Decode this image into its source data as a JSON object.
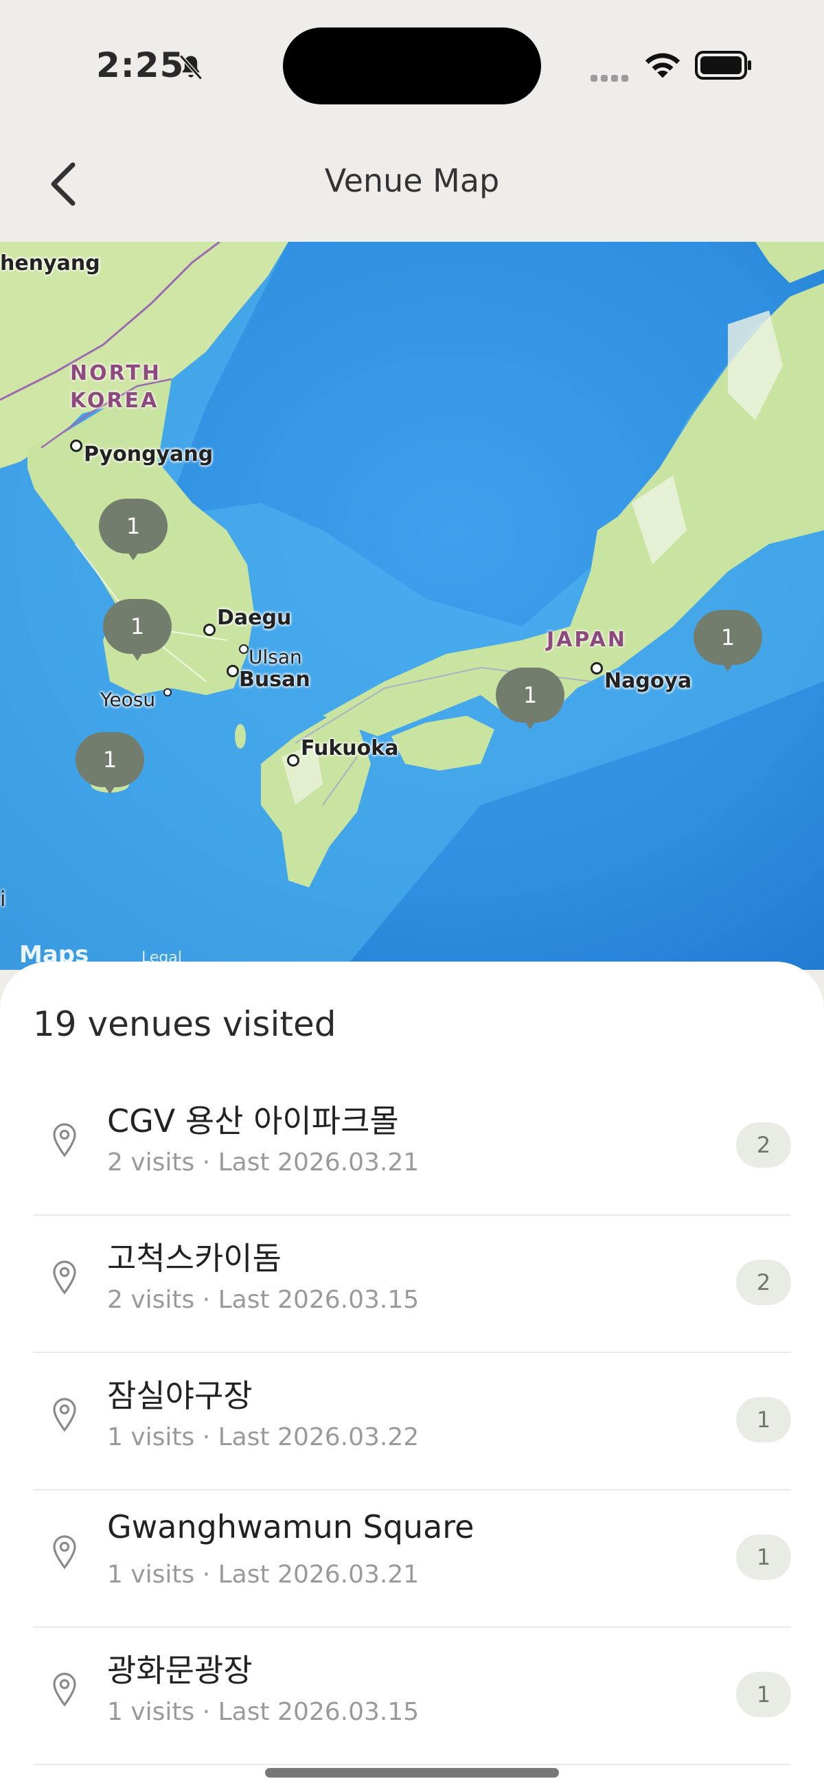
{
  "status": {
    "time": "2:25"
  },
  "header": {
    "title": "Venue Map"
  },
  "map": {
    "labels": {
      "shenyang": "henyang",
      "pyongyang": "Pyongyang",
      "daegu": "Daegu",
      "ulsan": "Ulsan",
      "busan": "Busan",
      "yeosu": "Yeosu",
      "fukuoka": "Fukuoka",
      "nagoya": "Nagoya",
      "edge": "i"
    },
    "countries": {
      "north_korea_1": "NORTH",
      "north_korea_2": "KOREA",
      "japan": "JAPAN"
    },
    "pins": [
      "1",
      "1",
      "1",
      "1",
      "1"
    ],
    "attribution": {
      "logo": "Maps",
      "legal": "Legal"
    }
  },
  "sheet": {
    "summary": "19 venues visited",
    "venues": [
      {
        "name": "CGV 용산 아이파크몰",
        "meta": "2 visits · Last 2026.03.21",
        "count": "2"
      },
      {
        "name": "고척스카이돔",
        "meta": "2 visits · Last 2026.03.15",
        "count": "2"
      },
      {
        "name": "잠실야구장",
        "meta": "1 visits · Last 2026.03.22",
        "count": "1"
      },
      {
        "name": "Gwanghwamun Square",
        "meta": "1 visits · Last 2026.03.21",
        "count": "1"
      },
      {
        "name": "광화문광장",
        "meta": "1 visits · Last 2026.03.15",
        "count": "1"
      }
    ]
  },
  "colors": {
    "background": "#efedea",
    "pin": "#737d6d",
    "badge": "#e8ece4",
    "land": "#cfe7a8",
    "sea": "#3a9be8"
  }
}
